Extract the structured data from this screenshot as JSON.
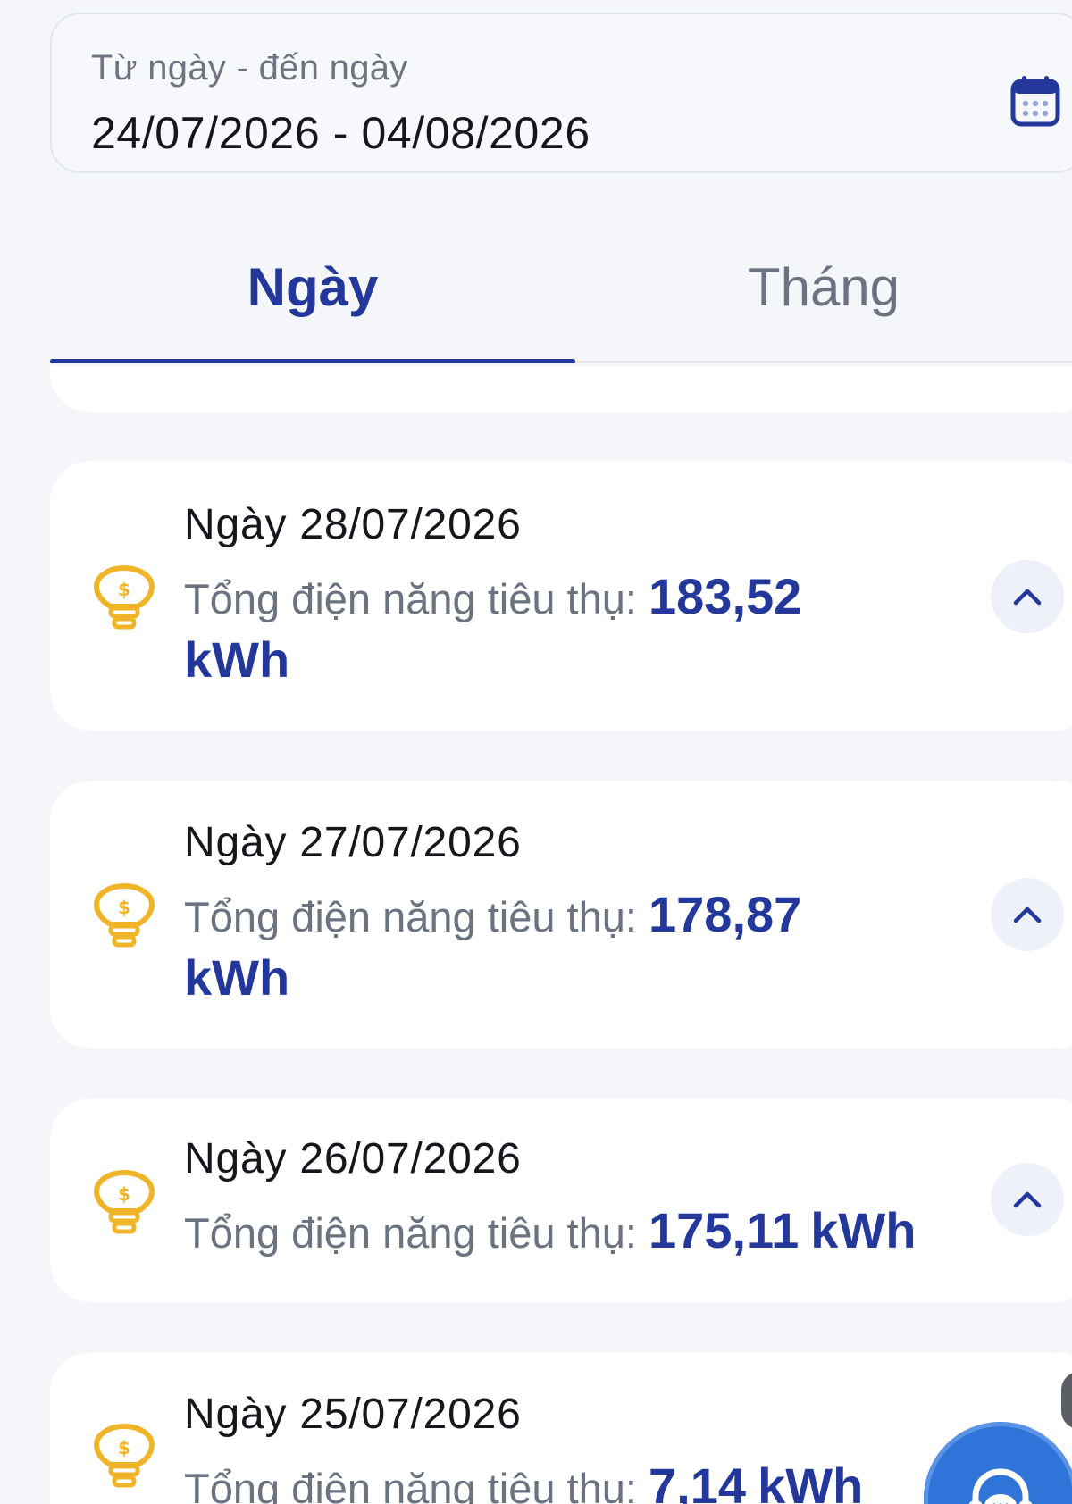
{
  "date_range": {
    "label": "Từ ngày - đến ngày",
    "value": "24/07/2026 - 04/08/2026"
  },
  "tabs": [
    {
      "label": "Ngày",
      "active": true
    },
    {
      "label": "Tháng",
      "active": false
    }
  ],
  "records": [
    {
      "date": "Ngày 28/07/2026",
      "label": "Tổng điện năng tiêu thụ:",
      "value": "183,52",
      "unit": "kWh"
    },
    {
      "date": "Ngày 27/07/2026",
      "label": "Tổng điện năng tiêu thụ:",
      "value": "178,87",
      "unit": "kWh"
    },
    {
      "date": "Ngày 26/07/2026",
      "label": "Tổng điện năng tiêu thụ:",
      "value": "175,11",
      "unit": "kWh"
    },
    {
      "date": "Ngày 25/07/2026",
      "label": "Tổng điện năng tiêu thụ:",
      "value": "7,14",
      "unit": "kWh"
    }
  ],
  "icons": {
    "calendar": "calendar-icon",
    "bulb": "lightbulb-icon",
    "expand": "chevron-up-icon",
    "support": "headset-support-icon"
  },
  "colors": {
    "accent": "#23389a",
    "bulb": "#f0b429",
    "muted_text": "#6b7280",
    "support_button": "#2e74d9"
  }
}
